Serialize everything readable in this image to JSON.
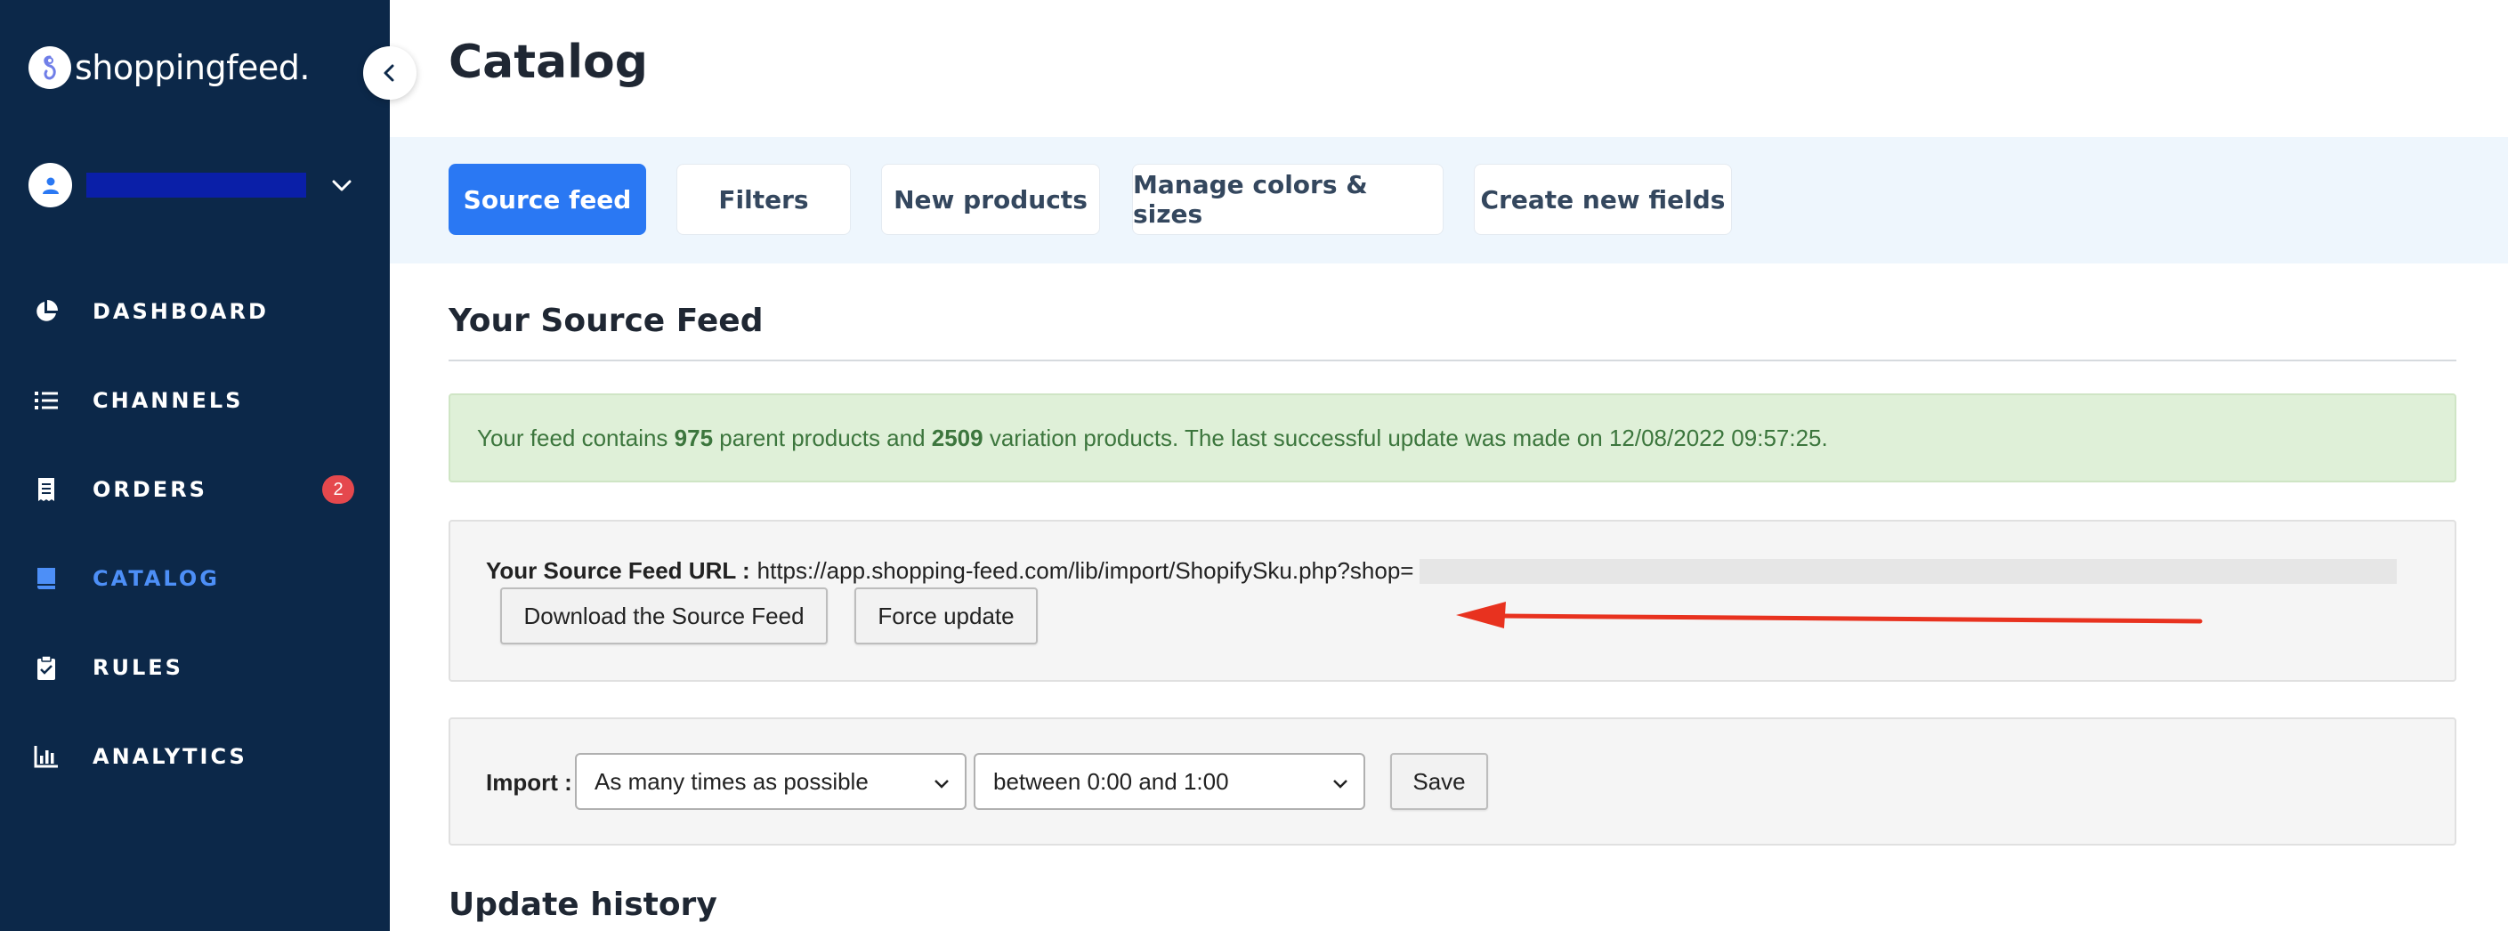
{
  "brand": {
    "name": "shoppingfeed."
  },
  "sidebar": {
    "items": [
      {
        "label": "DASHBOARD",
        "icon": "pie-chart-icon"
      },
      {
        "label": "CHANNELS",
        "icon": "list-icon"
      },
      {
        "label": "ORDERS",
        "icon": "receipt-icon",
        "badge": "2"
      },
      {
        "label": "CATALOG",
        "icon": "book-icon",
        "active": true
      },
      {
        "label": "RULES",
        "icon": "clipboard-icon"
      },
      {
        "label": "ANALYTICS",
        "icon": "bar-chart-icon"
      }
    ]
  },
  "page": {
    "title": "Catalog"
  },
  "tabs": [
    {
      "label": "Source feed",
      "active": true
    },
    {
      "label": "Filters"
    },
    {
      "label": "New products"
    },
    {
      "label": "Manage colors & sizes"
    },
    {
      "label": "Create new fields"
    }
  ],
  "source_feed": {
    "title": "Your Source Feed",
    "alert": {
      "prefix": "Your feed contains ",
      "parent_count": "975",
      "middle": " parent products and ",
      "variation_count": "2509",
      "suffix": " variation products. The last successful update was made on 12/08/2022 09:57:25."
    },
    "url_label": "Your Source Feed URL :",
    "url_value": "https://app.shopping-feed.com/lib/import/ShopifySku.php?shop=",
    "download_label": "Download the Source Feed",
    "force_update_label": "Force update"
  },
  "import": {
    "label": "Import :",
    "frequency": "As many times as possible",
    "time_window": "between 0:00 and 1:00",
    "save_label": "Save"
  },
  "update_history": {
    "title": "Update history"
  },
  "colors": {
    "sidebar_bg": "#0c2849",
    "accent": "#2a78f3",
    "active_nav": "#4d8ff7",
    "badge": "#e5484d",
    "alert_bg": "#dff0d8",
    "alert_text": "#3c763d",
    "annotation_arrow": "#e8321f"
  }
}
